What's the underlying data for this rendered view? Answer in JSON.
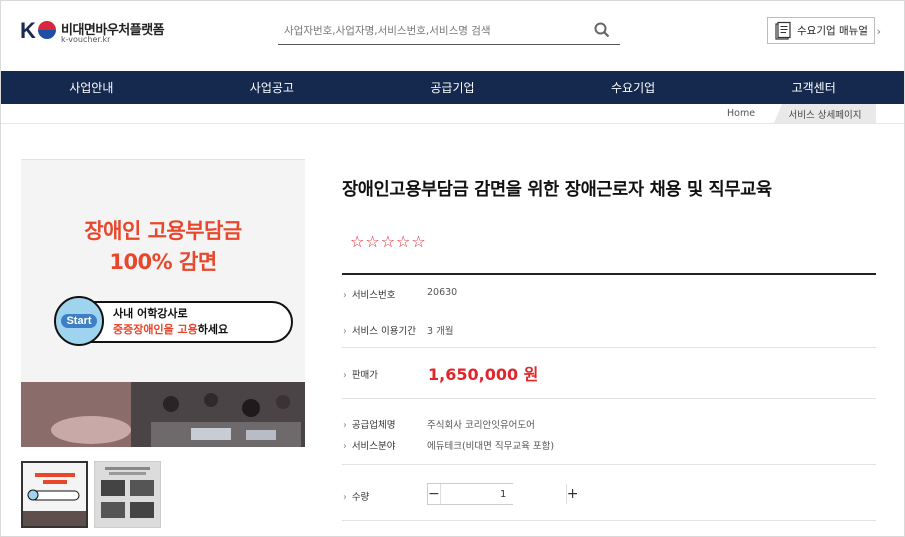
{
  "header": {
    "logo_mark": "K",
    "logo_title": "비대면바우처플랫폼",
    "logo_sub": "k-voucher.kr",
    "search_placeholder": "사업자번호,사업자명,서비스번호,서비스명 검색",
    "manual_label": "수요기업 매뉴얼"
  },
  "nav": [
    "사업안내",
    "사업공고",
    "공급기업",
    "수요기업",
    "고객센터"
  ],
  "breadcrumb": {
    "home": "Home",
    "current": "서비스 상세페이지"
  },
  "image": {
    "title_line1": "장애인 고용부담금",
    "title_line2": "100% 감면",
    "start": "Start",
    "pill_line1": "사내 어학강사로",
    "pill_line2_red": "중증장애인을 고용",
    "pill_line2_rest": "하세요"
  },
  "product": {
    "title": "장애인고용부담금 감면을 위한 장애근로자 채용 및 직무교육",
    "stars": "☆☆☆☆☆",
    "rows": {
      "service_no_label": "서비스번호",
      "service_no": "20630",
      "period_label": "서비스 이용기간",
      "period": "3 개월",
      "price_label": "판매가",
      "price": "1,650,000 원",
      "supplier_label": "공급업체명",
      "supplier": "주식회사 코리안잇유어도어",
      "field_label": "서비스분야",
      "field": "에듀테크(비대면 직무교육 포함)",
      "qty_label": "수량",
      "qty_minus": "−",
      "qty_value": "1",
      "qty_plus": "+"
    }
  },
  "colors": {
    "nav_bg": "#15294f",
    "accent_red": "#e0252b",
    "image_title": "#e8472c"
  }
}
